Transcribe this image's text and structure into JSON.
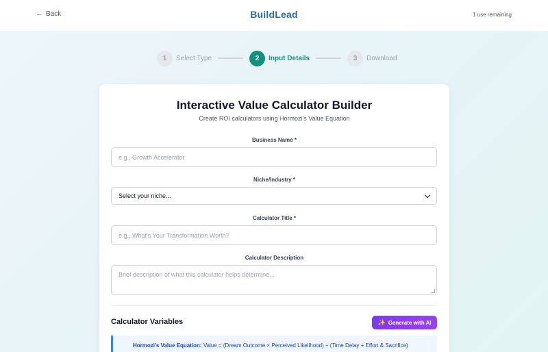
{
  "header": {
    "back_label": "Back",
    "brand": "BuildLead",
    "uses_remaining": "1 use remaining"
  },
  "stepper": {
    "steps": [
      {
        "number": "1",
        "label": "Select Type",
        "state": "inactive"
      },
      {
        "number": "2",
        "label": "Input Details",
        "state": "active"
      },
      {
        "number": "3",
        "label": "Download",
        "state": "inactive"
      }
    ]
  },
  "form": {
    "title": "Interactive Value Calculator Builder",
    "subtitle": "Create ROI calculators using Hormozi's Value Equation",
    "business_name": {
      "label": "Business Name *",
      "placeholder": "e.g., Growth Accelerator"
    },
    "niche": {
      "label": "Niche/Industry *",
      "selected": "Select your niche..."
    },
    "calc_title": {
      "label": "Calculator Title *",
      "placeholder": "e.g., What's Your Transformation Worth?"
    },
    "description": {
      "label": "Calculator Description",
      "placeholder": "Brief description of what this calculator helps determine..."
    }
  },
  "variables": {
    "section_title": "Calculator Variables",
    "generate_label": "Generate with AI",
    "equation_name": "Hormozi's Value Equation:",
    "equation_text": "Value = (Dream Outcome × Perceived Likelihood) ÷ (Time Delay + Effort & Sacrifice)"
  },
  "colors": {
    "brand": "#2b6cb0",
    "active_step": "#14907f",
    "ai_button": "#7c3aed",
    "equation_accent": "#3b82f6"
  }
}
